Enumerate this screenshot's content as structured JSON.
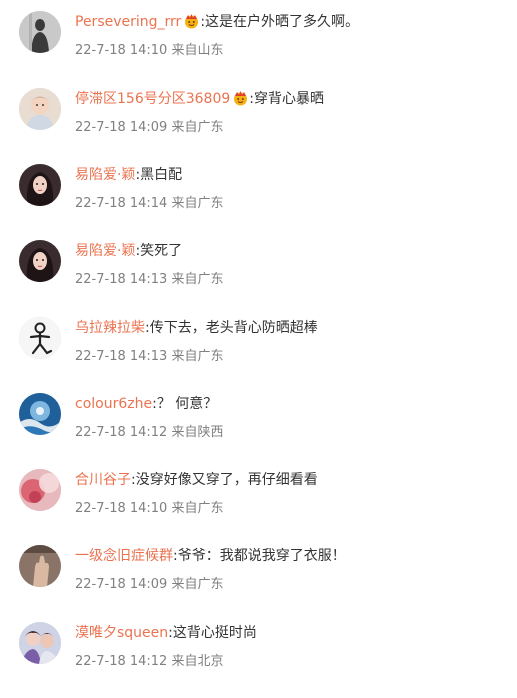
{
  "comments": [
    {
      "username": "Persevering_rrr",
      "has_badge": true,
      "separator": ":",
      "text": "这是在户外晒了多久啊。",
      "time": "22-7-18 14:10",
      "source": "来自山东",
      "avatar_icon": "silhouette-avatar"
    },
    {
      "username": "停滞区156号分区36809",
      "has_badge": true,
      "separator": ":",
      "text": "穿背心暴晒",
      "time": "22-7-18 14:09",
      "source": "来自广东",
      "avatar_icon": "baby-avatar"
    },
    {
      "username": "易陷爱·颖",
      "has_badge": false,
      "separator": ":",
      "text": "黑白配",
      "time": "22-7-18 14:14",
      "source": "来自广东",
      "avatar_icon": "girl-avatar"
    },
    {
      "username": "易陷爱·颖",
      "has_badge": false,
      "separator": ":",
      "text": "笑死了",
      "time": "22-7-18 14:13",
      "source": "来自广东",
      "avatar_icon": "girl-avatar"
    },
    {
      "username": "乌拉辣拉柴",
      "has_badge": false,
      "separator": ":",
      "text": "传下去，老头背心防晒超棒",
      "time": "22-7-18 14:13",
      "source": "来自广东",
      "avatar_icon": "stick-figure-avatar"
    },
    {
      "username": "colour6zhe",
      "has_badge": false,
      "separator": ":",
      "text": "？ 何意？",
      "time": "22-7-18 14:12",
      "source": "来自陕西",
      "avatar_icon": "blue-wave-avatar"
    },
    {
      "username": "合川谷子",
      "has_badge": false,
      "separator": ":",
      "text": "没穿好像又穿了，再仔细看看",
      "time": "22-7-18 14:10",
      "source": "来自广东",
      "avatar_icon": "pink-blur-avatar"
    },
    {
      "username": "一级念旧症候群",
      "has_badge": false,
      "separator": ":",
      "text": "爷爷：我都说我穿了衣服！",
      "time": "22-7-18 14:09",
      "source": "来自广东",
      "avatar_icon": "hand-avatar"
    },
    {
      "username": "漠唯夕squeen",
      "has_badge": false,
      "separator": ":",
      "text": "这背心挺时尚",
      "time": "22-7-18 14:12",
      "source": "来自北京",
      "avatar_icon": "couple-photo-avatar"
    }
  ],
  "colors": {
    "username": "#eb7350",
    "text": "#333333",
    "meta": "#808080",
    "badge": "#f5b014"
  }
}
